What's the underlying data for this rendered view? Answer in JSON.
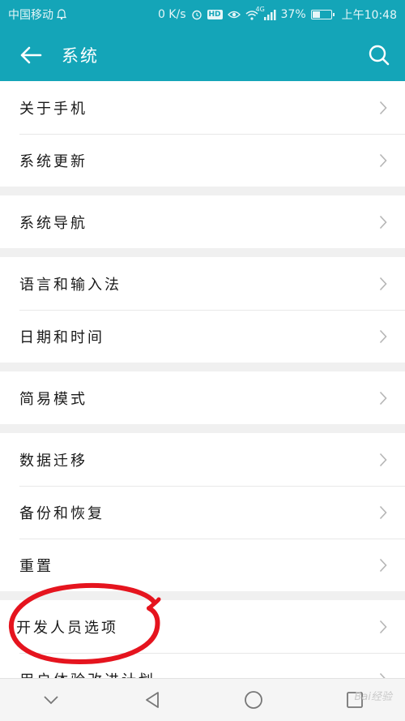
{
  "status_bar": {
    "carrier": "中国移动",
    "speed": "0 K/s",
    "hd_label": "HD",
    "network_label": "4G",
    "battery_text": "37%",
    "battery_level": 0.37,
    "time": "上午10:48"
  },
  "app_bar": {
    "title": "系统"
  },
  "groups": [
    [
      "关于手机",
      "系统更新"
    ],
    [
      "系统导航"
    ],
    [
      "语言和输入法",
      "日期和时间"
    ],
    [
      "简易模式"
    ],
    [
      "数据迁移",
      "备份和恢复",
      "重置"
    ],
    [
      "开发人员选项",
      "用户体验改进计划"
    ]
  ],
  "menu": {
    "about_phone": "关于手机",
    "system_update": "系统更新",
    "system_navigation": "系统导航",
    "language_input": "语言和输入法",
    "date_time": "日期和时间",
    "simple_mode": "简易模式",
    "data_migration": "数据迁移",
    "backup_restore": "备份和恢复",
    "reset": "重置",
    "developer_options": "开发人员选项",
    "user_experience": "用户体验改进计划"
  },
  "watermark": "Bai经验",
  "colors": {
    "accent": "#14a5b8",
    "annotation": "#e5141e"
  },
  "icons": {
    "back": "arrow-left",
    "search": "magnifier",
    "chevron": "chevron-right",
    "nav_down": "chevron-down",
    "nav_back": "triangle-left",
    "nav_home": "circle",
    "nav_recents": "square"
  }
}
